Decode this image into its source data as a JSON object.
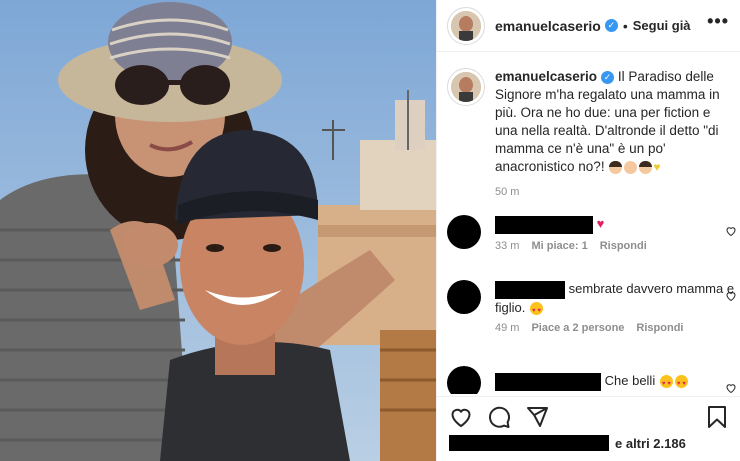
{
  "post": {
    "username": "emanuelcaserio",
    "follow_label": "Segui già",
    "more_label": "•••"
  },
  "caption": {
    "username": "emanuelcaserio",
    "text": "Il Paradiso delle Signore m'ha regalato una mamma in più. Ora ne ho due: una per fiction e una nella realtà. D'altronde il detto \"di mamma ce n'è una\" è un po' anacronistico no?!",
    "time": "50 m"
  },
  "comments": [
    {
      "text": "",
      "time": "33 m",
      "likes": "Mi piace: 1",
      "reply": "Rispondi"
    },
    {
      "text": "sembrate davvero mamma e figlio.",
      "time": "49 m",
      "likes": "Piace a 2 persone",
      "reply": "Rispondi"
    },
    {
      "text": "Che belli"
    }
  ],
  "likes_suffix": "e altri 2.186",
  "colors": {
    "verified": "#3897f0",
    "meta": "#8e8e8e",
    "text": "#262626"
  },
  "icons": [
    "verified-badge-icon",
    "heart-icon",
    "comment-icon",
    "share-icon",
    "bookmark-icon",
    "more-icon"
  ]
}
